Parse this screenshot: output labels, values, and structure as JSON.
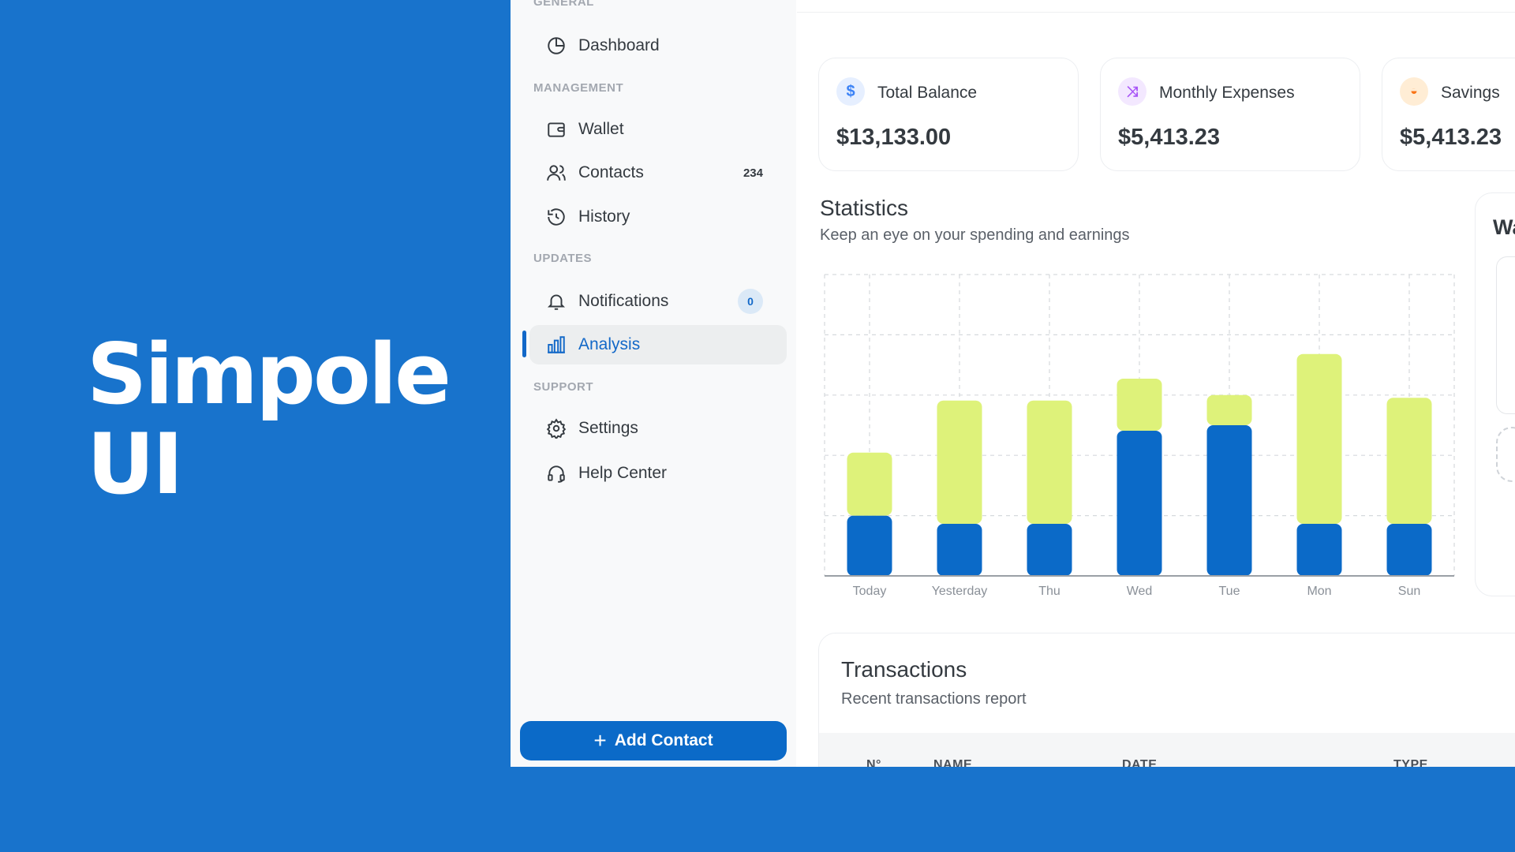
{
  "brand": {
    "line1": "Simpole",
    "line2": "UI"
  },
  "sidebar": {
    "sections": {
      "general": "GENERAL",
      "management": "MANAGEMENT",
      "updates": "UPDATES",
      "support": "SUPPORT"
    },
    "items": [
      {
        "label": "Dashboard",
        "icon": "dashboard-icon"
      },
      {
        "label": "Wallet",
        "icon": "wallet-icon"
      },
      {
        "label": "Contacts",
        "icon": "contacts-icon",
        "count": "234"
      },
      {
        "label": "History",
        "icon": "history-icon"
      },
      {
        "label": "Notifications",
        "icon": "bell-icon",
        "badge": "0"
      },
      {
        "label": "Analysis",
        "icon": "analysis-icon",
        "active": true
      },
      {
        "label": "Settings",
        "icon": "gear-icon"
      },
      {
        "label": "Help Center",
        "icon": "headset-icon"
      }
    ],
    "add_button": "Add Contact"
  },
  "cards": [
    {
      "label": "Total Balance",
      "value": "$13,133.00",
      "icon": "dollar-icon",
      "color": "#3b82f6"
    },
    {
      "label": "Monthly Expenses",
      "value": "$5,413.23",
      "icon": "shuffle-icon",
      "color": "#a855f7"
    },
    {
      "label": "Savings",
      "value": "$5,413.23",
      "icon": "piggy-bank-icon",
      "color": "#f97316"
    }
  ],
  "statistics": {
    "title": "Statistics",
    "subtitle": "Keep an eye on your spending and earnings"
  },
  "right_card": {
    "title": "Wa"
  },
  "chart_data": {
    "type": "bar",
    "stacked": true,
    "categories": [
      "Today",
      "Yesterday",
      "Thu",
      "Wed",
      "Tue",
      "Mon",
      "Sun"
    ],
    "series": [
      {
        "values": [
          22,
          19,
          19,
          53,
          55,
          19,
          19
        ],
        "color": "#0b6ac8"
      },
      {
        "values": [
          23,
          45,
          45,
          19,
          11,
          62,
          46
        ],
        "color": "#def27a"
      }
    ],
    "ylim": [
      0,
      110
    ],
    "grid": true
  },
  "transactions": {
    "title": "Transactions",
    "subtitle": "Recent transactions report",
    "columns": [
      "N°",
      "NAME",
      "DATE",
      "TYPE"
    ]
  },
  "colors": {
    "accent": "#0b6ac8",
    "background": "#1873cc",
    "lime": "#def27a"
  }
}
